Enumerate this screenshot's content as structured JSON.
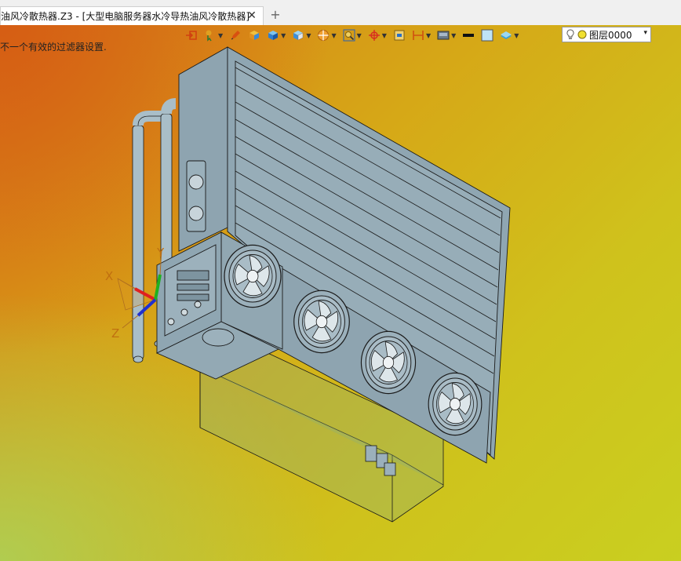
{
  "tab": {
    "title": "油风冷散热器.Z3 - [大型电脑服务器水冷导热油风冷散热器]",
    "close_glyph": "✕",
    "new_tab_glyph": "+"
  },
  "status": {
    "message": "不一个有效的过滤器设置."
  },
  "toolbar": {
    "items": [
      "import-icon",
      "pick-filter-icon",
      "pen-icon",
      "box-color-icon",
      "cube-icon",
      "cube-view-icon",
      "section-icon",
      "zoom-fit-icon",
      "move-icon",
      "frame-icon",
      "dimension-icon",
      "display-mode-icon",
      "line-color-icon",
      "fill-color-icon",
      "layer-style-icon",
      "light-bulb-icon",
      "layer-color-icon"
    ],
    "line_color": "#111111",
    "fill_color": "#bfe3f5"
  },
  "layer": {
    "name": "图层0000",
    "dropdown_glyph": "▾"
  },
  "axes": {
    "x_label": "X",
    "y_label": "Y",
    "z_label": "Z"
  },
  "colors": {
    "model_fill": "#8fa6b2",
    "model_edge": "#1a1a1a",
    "axis_x": "#e02020",
    "axis_y": "#20b020",
    "axis_z": "#2030d0"
  }
}
